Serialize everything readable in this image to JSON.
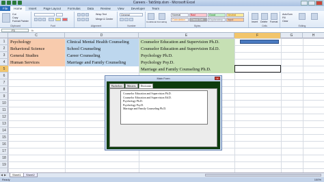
{
  "window": {
    "title": "Careers - TabStrip.xlsm - Microsoft Excel"
  },
  "ribbon": {
    "file_tab": "File",
    "tabs": [
      "Home",
      "Insert",
      "Page Layout",
      "Formulas",
      "Data",
      "Review",
      "View",
      "Developer",
      "Team"
    ],
    "active_tab": "Home",
    "clipboard": {
      "cut": "Cut",
      "copy": "Copy",
      "format_painter": "Format Painter",
      "label": "Clipboard"
    },
    "font": {
      "label": "Font"
    },
    "alignment": {
      "wrap_text": "Wrap Text",
      "merge_center": "Merge & Center",
      "label": "Alignment"
    },
    "number": {
      "format": "General",
      "label": "Number"
    },
    "styles": {
      "conditional": "Conditional Formatting",
      "format_as_table": "Format as Table",
      "label": "Styles",
      "cells": [
        {
          "name": "Normal",
          "bg": "#ffffff"
        },
        {
          "name": "Bad",
          "bg": "#ffc7ce"
        },
        {
          "name": "Good",
          "bg": "#c6efce"
        },
        {
          "name": "Neutral",
          "bg": "#ffeb9c"
        },
        {
          "name": "Calculation",
          "bg": "#f2f2f2"
        },
        {
          "name": "Check Cell",
          "bg": "#a5a5a5"
        },
        {
          "name": "Explanatory",
          "bg": "#ffffff"
        },
        {
          "name": "Input",
          "bg": "#ffcc99"
        }
      ]
    },
    "cells_group": {
      "insert": "Insert",
      "delete": "Delete",
      "format": "Format",
      "label": "Cells"
    },
    "editing": {
      "autosum": "AutoSum",
      "fill": "Fill",
      "clear": "Clear",
      "sort": "Sort & Filter",
      "find": "Find & Select",
      "label": "Editing"
    }
  },
  "formula_bar": {
    "name_box": "F5",
    "fx": "fx",
    "content": ""
  },
  "columns": [
    "C",
    "D",
    "E",
    "F",
    "G",
    "H"
  ],
  "selected_column": "F",
  "rows": [
    "1",
    "2",
    "3",
    "4",
    "5",
    "6",
    "7",
    "8",
    "9",
    "10",
    "11",
    "12",
    "13",
    "14",
    "15",
    "16",
    "17",
    "18",
    "19"
  ],
  "selected_row": "5",
  "cells": {
    "c1": "Psychology",
    "c2": "Behavioral Science",
    "c3": "General Studies",
    "c4": "Human Services",
    "d1": "Clinical Mental Health Counseling",
    "d2": "School Counseling",
    "d3": "Career Counseling",
    "d4": "Marriage and Family Counseling",
    "e1": "Counselor Education and Supervision Ph.D.",
    "e2": "Counselor Education and Supervision Ed.D.",
    "e3": "Psychology Ph.D.",
    "e4": "Psychology Psy.D.",
    "e5": "Marriage and Family Counseling Ph.D."
  },
  "colors": {
    "bachelors": "#f8cbad",
    "masters": "#bdd7ee",
    "doctorate": "#c6e0b4",
    "selection_header": "#f2c56b",
    "form_background": "#0d3b0d"
  },
  "userform": {
    "title": "Main Form",
    "tabs": [
      "Bachelors",
      "Masters",
      "Doctorate"
    ],
    "active_tab": "Doctorate",
    "list_items": [
      "Counselor Education and Supervision Ph.D.",
      "Counselor Education and Supervision Ed.D.",
      "Psychology Ph.D.",
      "Psychology Psy.D.",
      "Marriage and Family Counseling Ph.D."
    ]
  },
  "sheet_tabs": [
    "Sheet1",
    "Sheet2"
  ],
  "active_sheet": "Sheet1",
  "status": {
    "ready": "Ready",
    "zoom": "100%"
  }
}
